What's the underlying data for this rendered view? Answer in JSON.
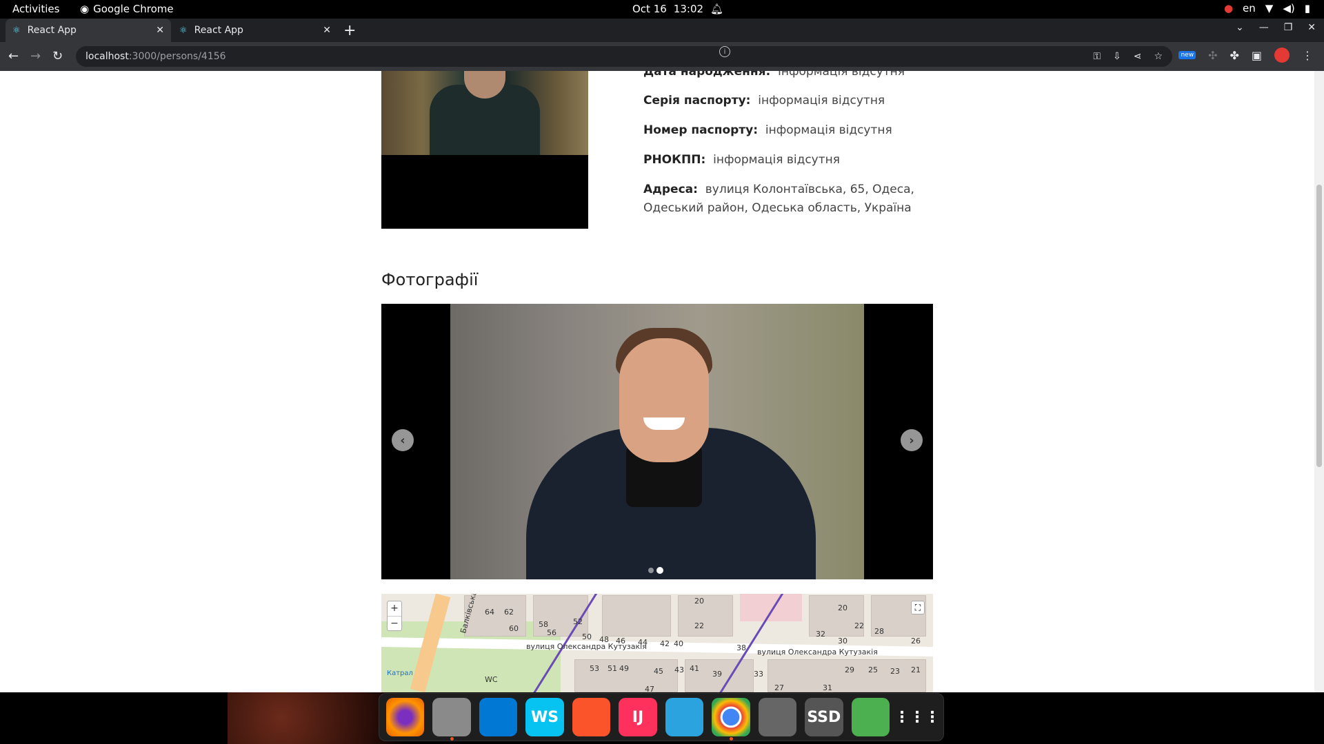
{
  "topbar": {
    "activities": "Activities",
    "app_name": "Google Chrome",
    "date": "Oct 16",
    "time": "13:02",
    "lang": "en"
  },
  "tabs": [
    {
      "title": "React App",
      "active": true
    },
    {
      "title": "React App",
      "active": false
    }
  ],
  "address": {
    "host": "localhost",
    "path": ":3000/persons/4156"
  },
  "extensions": {
    "badge": "new"
  },
  "person": {
    "fields": [
      {
        "label": "Дата народження:",
        "value": "інформація відсутня"
      },
      {
        "label": "Серія паспорту:",
        "value": "інформація відсутня"
      },
      {
        "label": "Номер паспорту:",
        "value": "інформація відсутня"
      },
      {
        "label": "РНОКПП:",
        "value": "інформація відсутня"
      },
      {
        "label": "Адреса:",
        "value": "вулиця Колонтаївська, 65, Одеса,",
        "value2": "Одеський район, Одеська область, Україна"
      }
    ]
  },
  "photos": {
    "title": "Фотографії",
    "slide_count": 2,
    "active_slide": 2
  },
  "map": {
    "street_1": "вулиця Олександра Кутузакія",
    "street_2": "вулиця Олександра Кутузакія",
    "street_3": "Балківська",
    "poi": "Катрал",
    "wc": "WC",
    "zoom_in": "+",
    "zoom_out": "−",
    "numbers": [
      "64",
      "62",
      "60",
      "58",
      "56",
      "52",
      "50",
      "48",
      "46",
      "44",
      "42",
      "40",
      "22",
      "20",
      "38",
      "32",
      "30",
      "28",
      "26",
      "20",
      "22",
      "53",
      "51",
      "49",
      "47",
      "45",
      "43",
      "41",
      "39",
      "33",
      "31",
      "29",
      "27",
      "25",
      "23",
      "21"
    ]
  },
  "dock": [
    {
      "name": "firefox",
      "label": "",
      "color": "#e66000"
    },
    {
      "name": "files",
      "label": "",
      "color": "#8a8a8a"
    },
    {
      "name": "vscode",
      "label": "",
      "color": "#0078d4"
    },
    {
      "name": "webstorm",
      "label": "WS",
      "color": "#07c3f2"
    },
    {
      "name": "brave",
      "label": "",
      "color": "#fb542b"
    },
    {
      "name": "intellij",
      "label": "IJ",
      "color": "#fe315d"
    },
    {
      "name": "telegram",
      "label": "",
      "color": "#2aa3df"
    },
    {
      "name": "chrome",
      "label": "",
      "color": "#4285f4"
    },
    {
      "name": "disk",
      "label": "",
      "color": "#666666"
    },
    {
      "name": "ssd",
      "label": "SSD",
      "color": "#555555"
    },
    {
      "name": "trash",
      "label": "",
      "color": "#4caf50"
    },
    {
      "name": "app-grid",
      "label": "",
      "color": "#1e1e1e"
    }
  ]
}
